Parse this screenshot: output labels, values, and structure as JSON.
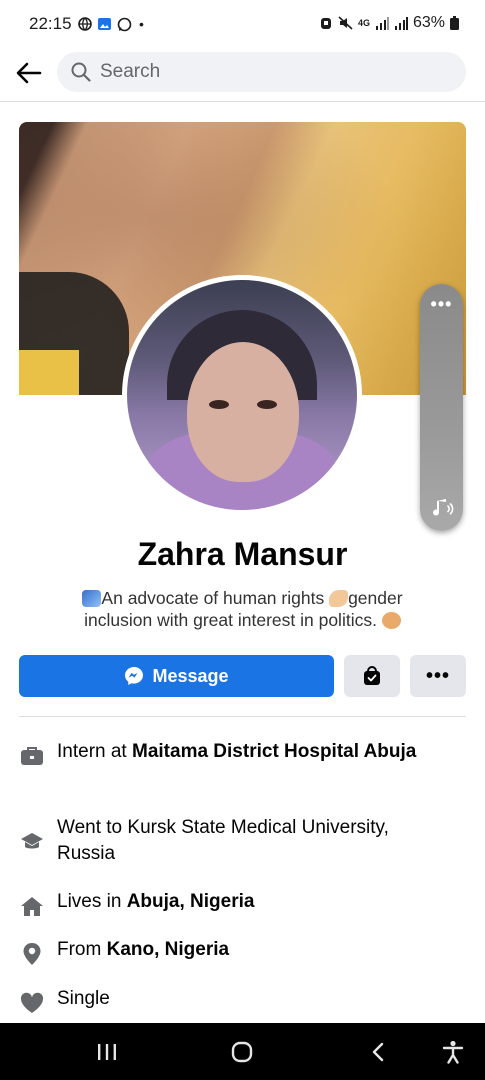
{
  "status_bar": {
    "time": "22:15",
    "dot": "•",
    "network": "4G",
    "battery": "63%",
    "left_icons": [
      "vpn-globe-icon",
      "gallery-icon",
      "whatsapp-icon"
    ],
    "right_icons": [
      "alarm-icon",
      "mute-icon",
      "signal-icon",
      "signal-icon",
      "battery-icon"
    ]
  },
  "header": {
    "search_placeholder": "Search",
    "back_icon": "back-arrow-icon",
    "search_icon": "search-icon"
  },
  "volume_overlay": {
    "menu_label": "•••",
    "icon": "music-volume-icon"
  },
  "profile": {
    "name": "Zahra Mansur",
    "bio_part1": "An advocate of human rights ",
    "bio_part2": "gender inclusion with great interest in politics. ",
    "bio_emojis": [
      "scales-emoji",
      "flexed-biceps-emoji",
      "ok-hand-emoji"
    ]
  },
  "actions": {
    "message_label": "Message",
    "more_label": "•••",
    "accent": "#1b74e4"
  },
  "details": [
    {
      "icon": "work-briefcase-icon",
      "prefix": "Intern at ",
      "bold": "Maitama District Hospital Abuja"
    },
    {
      "icon": "education-cap-icon",
      "prefix": "Went to Kursk State Medical University, Russia",
      "bold": ""
    },
    {
      "icon": "home-icon",
      "prefix": "Lives in ",
      "bold": "Abuja, Nigeria"
    },
    {
      "icon": "location-pin-icon",
      "prefix": "From ",
      "bold": "Kano, Nigeria"
    },
    {
      "icon": "heart-icon",
      "prefix": "Single",
      "bold": ""
    }
  ],
  "nav_bar": {
    "recent_icon": "recent-apps-icon",
    "home_icon": "home-button-icon",
    "back_icon": "back-chevron-icon",
    "accessibility_icon": "accessibility-icon"
  }
}
